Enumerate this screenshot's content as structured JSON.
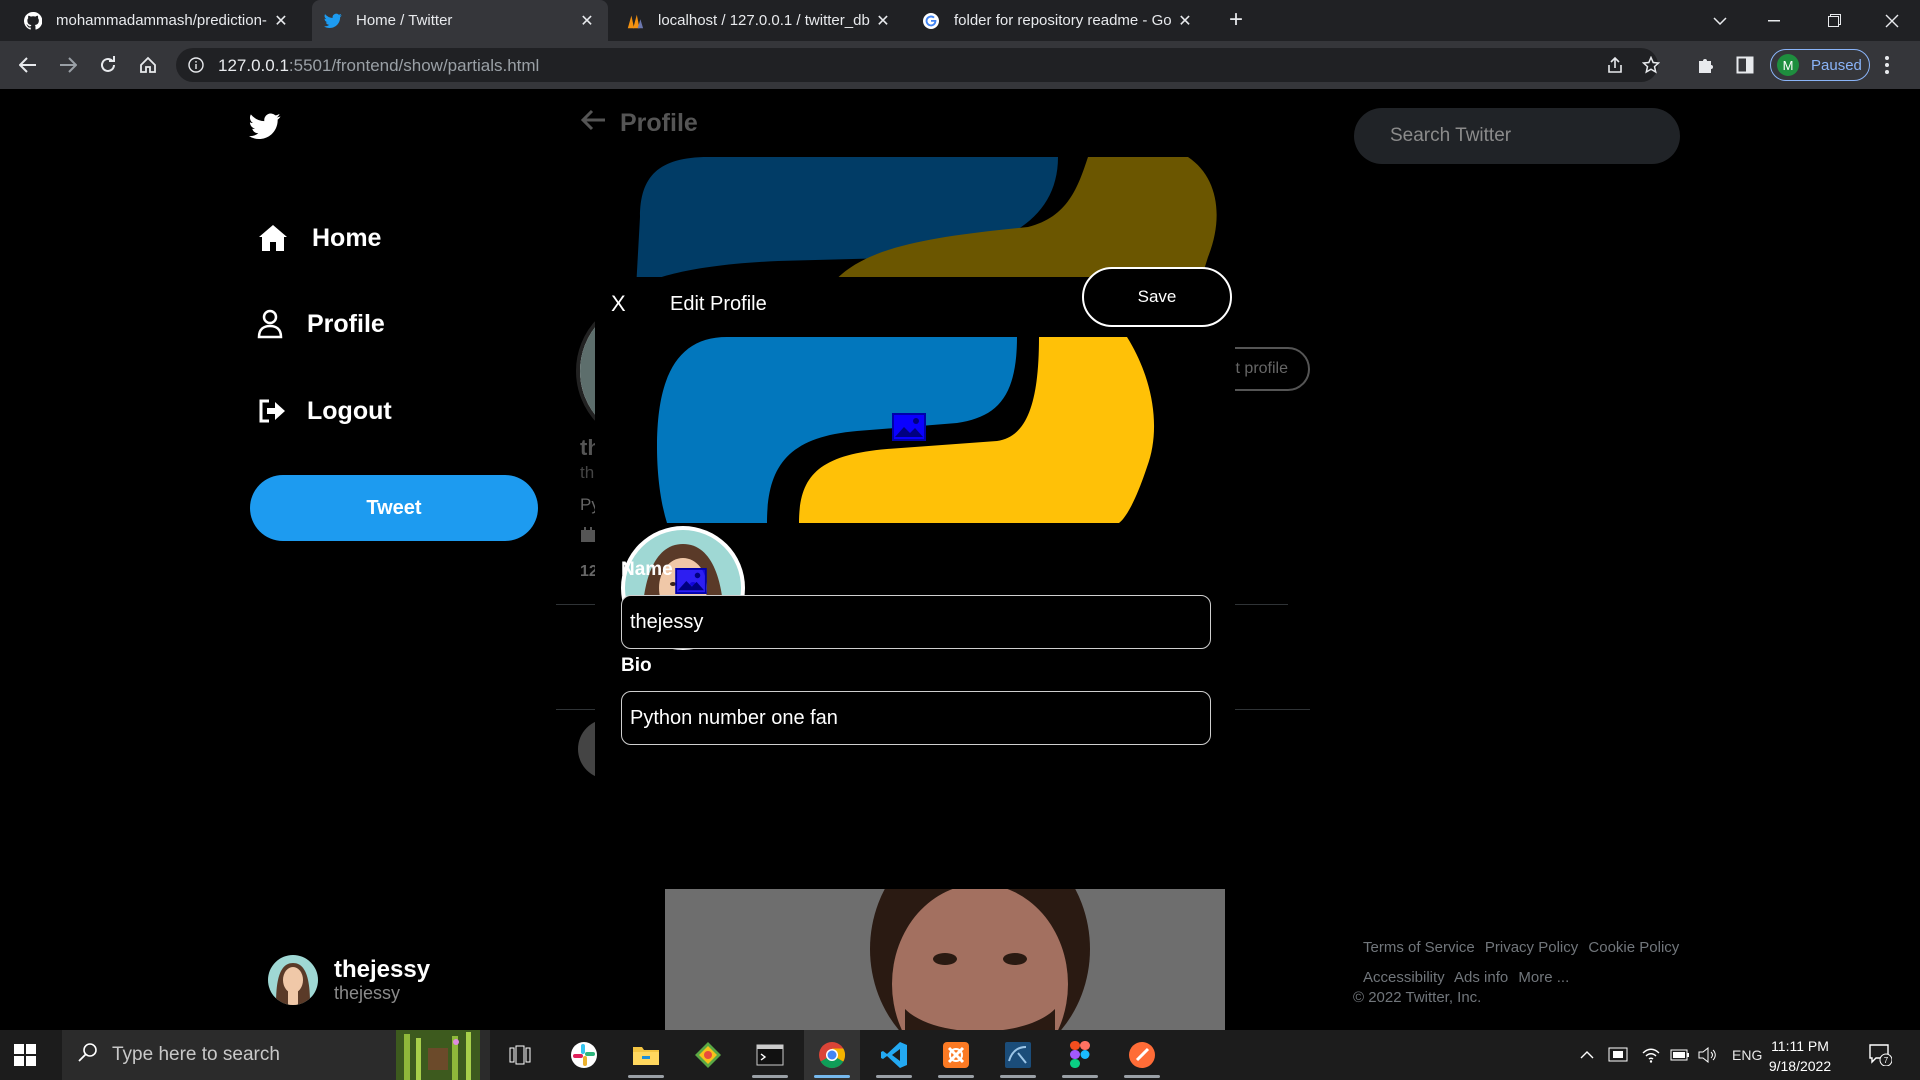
{
  "browser": {
    "tabs": [
      {
        "title": "mohammadammash/prediction-",
        "icon": "github-icon"
      },
      {
        "title": "Home / Twitter",
        "icon": "twitter-icon"
      },
      {
        "title": "localhost / 127.0.0.1 / twitter_db",
        "icon": "phpmyadmin-icon"
      },
      {
        "title": "folder for repository readme - Go",
        "icon": "google-icon"
      }
    ],
    "url_host": "127.0.0.1",
    "url_path": ":5501/frontend/show/partials.html",
    "profile_initial": "M",
    "profile_status": "Paused"
  },
  "sidebar": {
    "items": [
      {
        "label": "Home",
        "icon": "home-icon"
      },
      {
        "label": "Profile",
        "icon": "user-icon"
      },
      {
        "label": "Logout",
        "icon": "logout-icon"
      }
    ],
    "tweet_label": "Tweet",
    "user": {
      "name": "thejessy",
      "handle": "thejessy"
    }
  },
  "main": {
    "header_title": "Profile",
    "edit_profile_fragment": "t profile",
    "name_fragment": "th",
    "handle_fragment": "th",
    "bio_fragment": "Py",
    "count_fragment": "12"
  },
  "right": {
    "search_placeholder": "Search Twitter",
    "footer": {
      "links_row1": [
        "Terms of Service",
        "Privacy Policy",
        "Cookie Policy"
      ],
      "links_row2": [
        "Accessibility",
        "Ads info",
        "More ..."
      ],
      "copyright": "© 2022 Twitter, Inc."
    }
  },
  "modal": {
    "close_label": "X",
    "title": "Edit Profile",
    "save_label": "Save",
    "name_label": "Name",
    "name_value": "thejessy",
    "bio_label": "Bio",
    "bio_value": "Python number one fan"
  },
  "taskbar": {
    "search_placeholder": "Type here to search",
    "time": "11:11 PM",
    "date": "9/18/2022",
    "lang": "ENG",
    "notification_count": "7"
  },
  "colors": {
    "twitter_blue": "#1d9bf0",
    "python_blue": "#0277bd",
    "python_yellow": "#ffc107"
  }
}
